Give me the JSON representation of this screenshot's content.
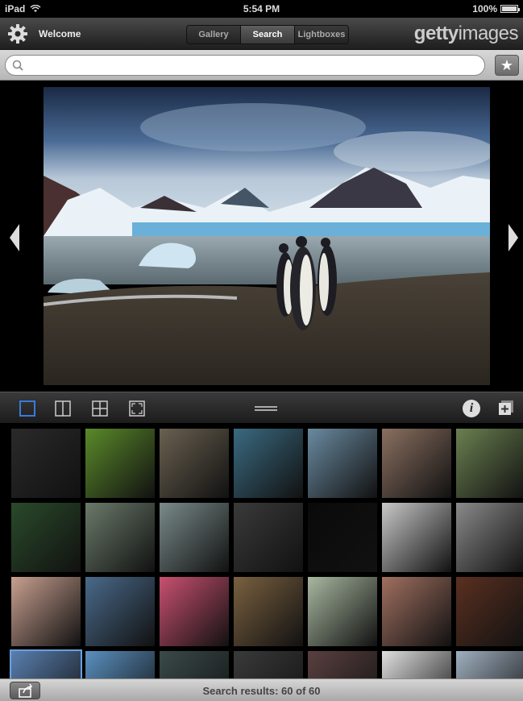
{
  "status": {
    "carrier": "iPad",
    "time": "5:54 PM",
    "battery": "100%"
  },
  "nav": {
    "welcome": "Welcome",
    "tabs": [
      {
        "label": "Gallery",
        "active": false
      },
      {
        "label": "Search",
        "active": true
      },
      {
        "label": "Lightboxes",
        "active": false
      }
    ],
    "brand_bold": "getty",
    "brand_light": "images"
  },
  "search": {
    "value": "",
    "placeholder": ""
  },
  "hero": {
    "subject": "king penguins on beach with glacier and mountains"
  },
  "toolbar": {
    "icons": [
      "single-view-icon",
      "two-column-icon",
      "grid-icon",
      "fullscreen-icon",
      "grip-handle-icon",
      "info-icon",
      "add-to-lightbox-icon"
    ]
  },
  "thumbnails": {
    "selected_index": 21,
    "colors": [
      [
        "#2a2a2a",
        "#5a8a2a",
        "#6a6050",
        "#3a6a80",
        "#6a8aa0",
        "#8a7060",
        "#6a8050"
      ],
      [
        "#2a4a2a",
        "#6a7a6a",
        "#7a8a8a",
        "#3a3a3a",
        "#0a0a0a",
        "#c8c8c8",
        "#8a8a8a"
      ],
      [
        "#c8a090",
        "#4a6a8a",
        "#c85070",
        "#7a6040",
        "#a8b8a0",
        "#a07060",
        "#5a3020"
      ],
      [
        "#5a80b0",
        "#5a90c0",
        "#3a4a4a",
        "#3a3a3a",
        "#5a4040",
        "#e0e0e0",
        "#a0b0c0"
      ]
    ]
  },
  "bottom": {
    "results": "Search results: 60 of 60"
  }
}
